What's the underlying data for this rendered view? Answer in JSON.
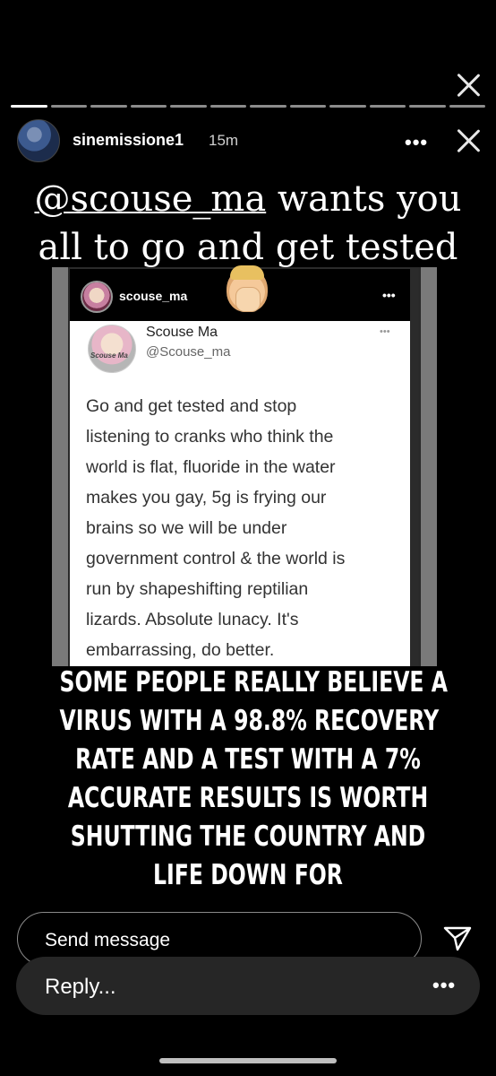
{
  "header": {
    "username": "sinemissione1",
    "time": "15m",
    "more_label": "•••"
  },
  "headline": {
    "mention": "@scouse_ma",
    "line1_rest": " wants you",
    "line2": "all to go and get tested"
  },
  "embedded_post": {
    "username": "scouse_ma",
    "more_label": "•••"
  },
  "tweet": {
    "name": "Scouse Ma",
    "handle": "@Scouse_ma",
    "avatar_text": "Scouse Ma",
    "more_label": "•••",
    "lines": [
      "Go and get tested and stop",
      "listening to cranks who think the",
      "world is flat, fluoride in the water",
      "makes you gay, 5g is frying our",
      "brains so we will be under",
      "government control & the world is",
      "run by shapeshifting reptilian",
      "lizards. Absolute lunacy. It's",
      "embarrassing, do better."
    ]
  },
  "caption": {
    "lines": [
      "SOME PEOPLE REALLY BELIEVE A",
      "VIRUS WITH A 98.8% RECOVERY",
      "RATE AND A TEST WITH A 7%",
      "ACCURATE RESULTS IS WORTH",
      "SHUTTING THE COUNTRY AND",
      "LIFE DOWN FOR"
    ]
  },
  "composer": {
    "send_placeholder": "Send message",
    "reply_placeholder": "Reply...",
    "reply_more_label": "•••"
  },
  "progress": {
    "segments": 12,
    "active_index": 0
  },
  "icons": [
    "close-icon",
    "more-icon",
    "send-icon",
    "facepalm-emoji-icon"
  ]
}
